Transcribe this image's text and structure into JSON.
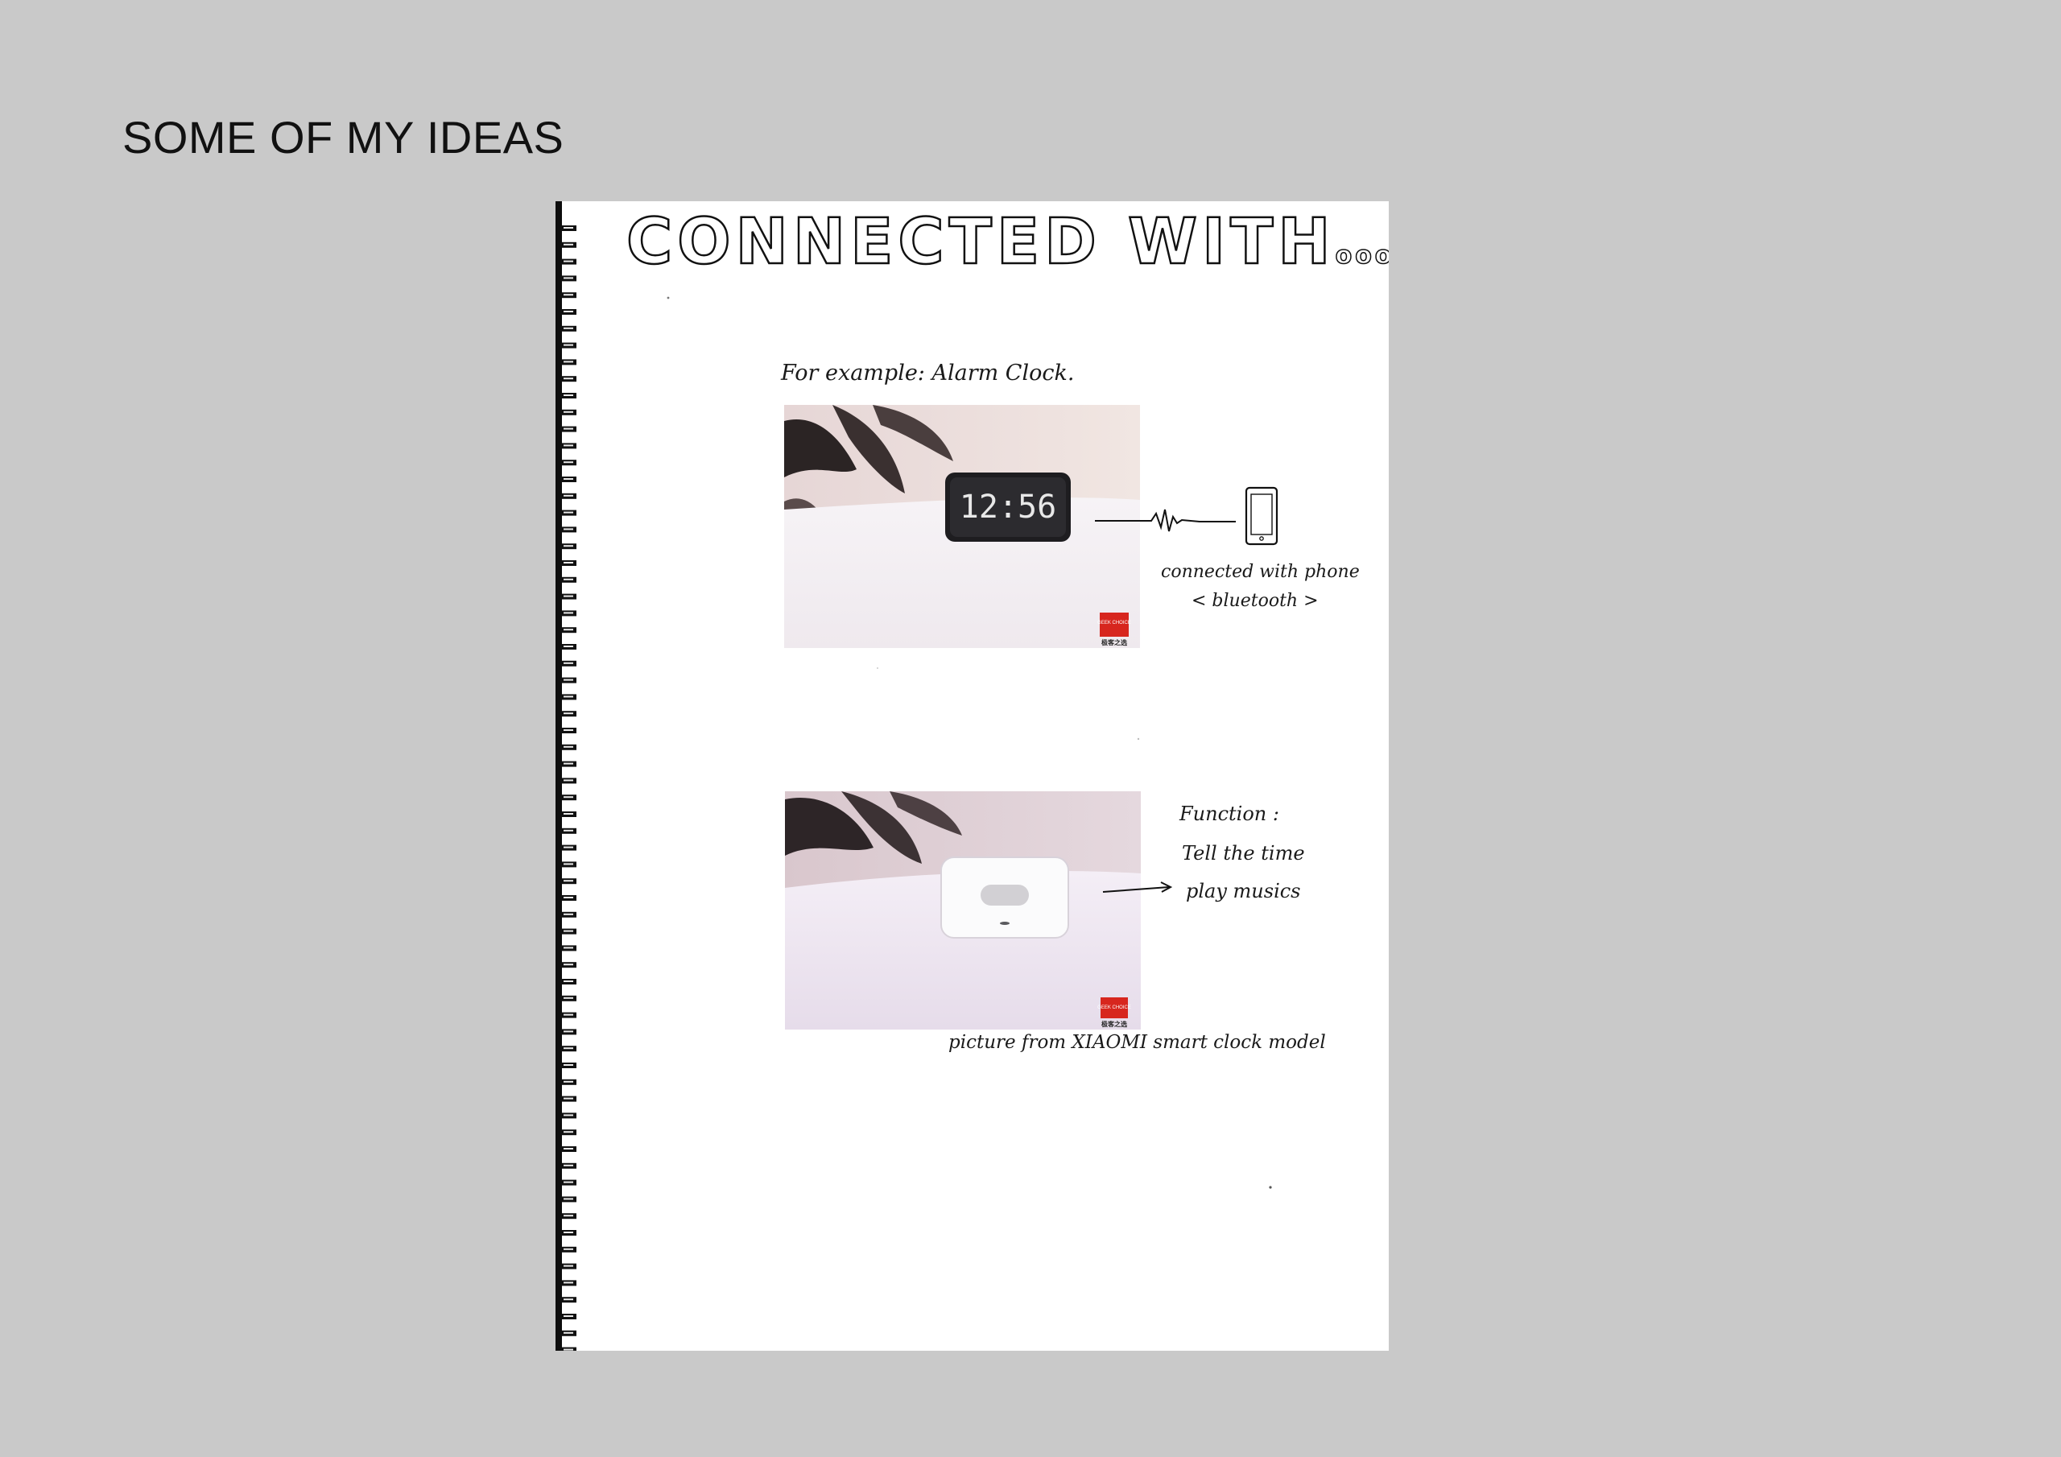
{
  "slide": {
    "title": "SOME OF MY IDEAS"
  },
  "sheet": {
    "heading": "CONNECTED WITH",
    "heading_trail": "ooo",
    "example_label": "For example:  Alarm Clock.",
    "photo1": {
      "clock_display": "12:56",
      "badge_text": "GEEK CHOICE",
      "badge_caption": "极客之选"
    },
    "connection_note_line1": "connected  with  phone",
    "connection_note_line2": "< bluetooth >",
    "photo2": {
      "badge_text": "GEEK CHOICE",
      "badge_caption": "极客之选"
    },
    "function_title": "Function :",
    "function_items": [
      "Tell the time",
      "play musics"
    ],
    "photo_credit": "picture from  XIAOMI  smart clock model"
  },
  "colors": {
    "background": "#c9c9c9",
    "paper": "#ffffff",
    "ink": "#1a1a1a",
    "badge_red": "#d7261e"
  }
}
